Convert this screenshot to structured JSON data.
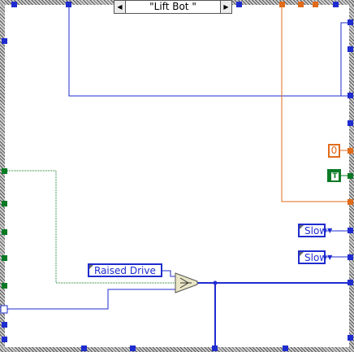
{
  "case_selector": {
    "value": "\"Lift Bot \"",
    "decrement_glyph": "◀",
    "increment_glyph": "▶"
  },
  "constants": {
    "numeric": "0",
    "boolean": "T"
  },
  "enums": {
    "raised_drive": "Raised Drive",
    "slow_1": "Slow",
    "slow_2": "Slow",
    "dropdown_glyph": "▼"
  },
  "colors": {
    "wire_blue": "#1f2ccf",
    "wire_orange": "#e06b1a",
    "wire_green": "#0b7a25",
    "select_node": "#e9e6c6"
  }
}
